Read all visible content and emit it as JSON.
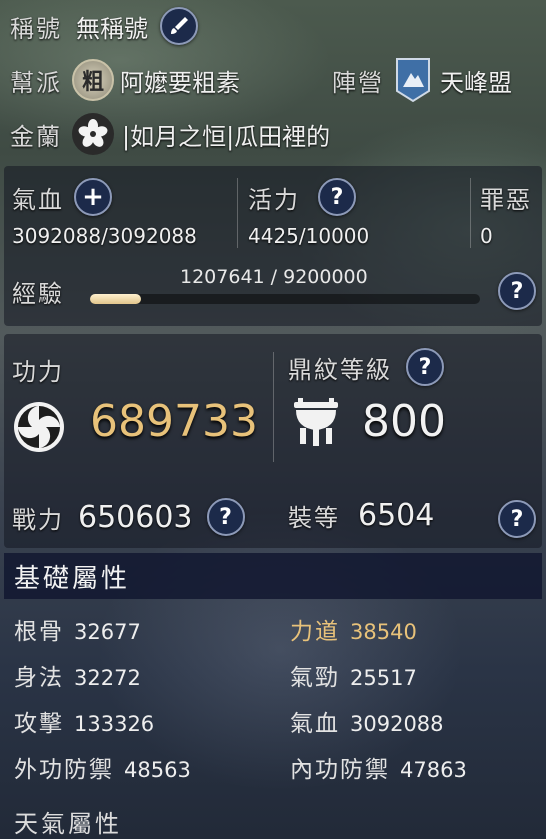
{
  "title_row": {
    "label": "稱號",
    "value": "無稱號"
  },
  "guild_row": {
    "label": "幫派",
    "badge": "粗",
    "value": "阿嬤要粗素"
  },
  "camp_row": {
    "label": "陣營",
    "value": "天峰盟"
  },
  "jinlan_row": {
    "label": "金蘭",
    "value": "|如月之恒|瓜田裡的"
  },
  "stats": {
    "hp_label": "氣血",
    "hp_value": "3092088/3092088",
    "vigor_label": "活力",
    "vigor_value": "4425/10000",
    "sin_label": "罪惡",
    "sin_value": "0",
    "exp_label": "經驗",
    "exp_value": "1207641 / 9200000",
    "exp_progress": 0.131
  },
  "power": {
    "gongli_label": "功力",
    "gongli_value": "689733",
    "dingwen_label": "鼎紋等級",
    "dingwen_value": "800",
    "combat_label": "戰力",
    "combat_value": "650603",
    "gear_label": "裝等",
    "gear_value": "6504"
  },
  "basic_attrs": {
    "header": "基礎屬性",
    "items": [
      {
        "k": "根骨",
        "v": "32677"
      },
      {
        "k": "力道",
        "v": "38540"
      },
      {
        "k": "身法",
        "v": "32272"
      },
      {
        "k": "氣勁",
        "v": "25517"
      },
      {
        "k": "攻擊",
        "v": "133326"
      },
      {
        "k": "氣血",
        "v": "3092088"
      },
      {
        "k": "外功防禦",
        "v": "48563"
      },
      {
        "k": "內功防禦",
        "v": "47863"
      }
    ],
    "next_header": "天氣屬性"
  },
  "colors": {
    "gold": "#e8c27a",
    "button_bg": "#1c2a4a",
    "section_bg": "#12182f"
  },
  "icons": [
    "brush-icon",
    "guild-badge-icon",
    "camp-flag-icon",
    "flower-icon",
    "plus-icon",
    "help-icon",
    "swirl-icon",
    "cauldron-icon"
  ]
}
